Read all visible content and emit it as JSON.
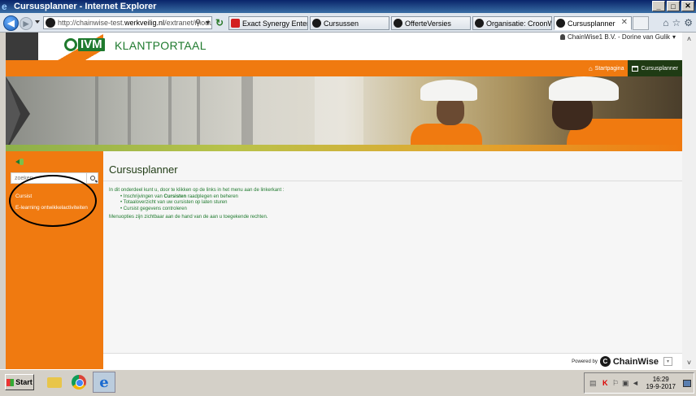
{
  "window": {
    "title": "Cursusplanner - Internet Explorer",
    "controls": [
      "_",
      "□",
      "✕"
    ]
  },
  "browser": {
    "address_prefix": "http://chainwise-test.",
    "address_domain": "werkveilig.nl",
    "address_suffix": "/extranet/modules/cur",
    "tabs": [
      {
        "label": "Exact Synergy Enterpris...",
        "icon": "exact-icon"
      },
      {
        "label": "Cursussen",
        "icon": "chainwise-icon"
      },
      {
        "label": "OfferteVersies",
        "icon": "chainwise-icon"
      },
      {
        "label": "Organisatie: CroonWolt...",
        "icon": "chainwise-icon"
      },
      {
        "label": "Cursusplanner",
        "icon": "chainwise-icon",
        "active": true
      }
    ]
  },
  "header": {
    "user": "ChainWise1 B.V. - Dorine van Gulik",
    "logo_text": "IVM",
    "portal_title": "KLANTPORTAAL"
  },
  "menu": {
    "home_label": "Startpagina",
    "planner_label": "Cursusplanner"
  },
  "sidebar": {
    "search_placeholder": "zoeken",
    "items": [
      {
        "label": "Cursist"
      },
      {
        "label": "E-learning ontwikkelactiviteiten"
      }
    ]
  },
  "content": {
    "title": "Cursusplanner",
    "intro": "In dit onderdeel kunt u, door te klikken op de links in het menu aan de linkerkant :",
    "bullet1_pre": "Inschrijvingen van ",
    "bullet1_bold": "Cursisten",
    "bullet1_post": " raadplegen en beheren",
    "bullet2": "Totaaloverzicht van uw cursisten op laten sturen",
    "bullet3": "Cursist gegevens controleren",
    "note": "Menuopties zijn zichtbaar aan de hand van de aan u toegekende rechten."
  },
  "footer": {
    "powered_by": "Powered by",
    "brand": "ChainWise"
  },
  "taskbar": {
    "start_label": "Start",
    "time": "16:29",
    "date": "19-9-2017"
  },
  "colors": {
    "orange": "#f07a10",
    "green": "#1f7a2e",
    "dark_green": "#1f3b14"
  }
}
